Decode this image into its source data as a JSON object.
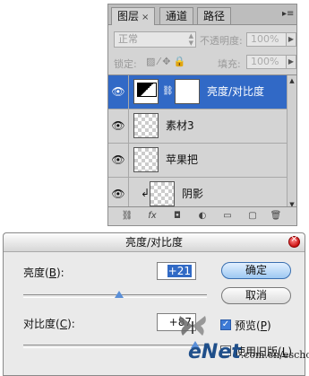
{
  "layers_panel": {
    "tabs": [
      {
        "label": "图层",
        "close": "×"
      },
      {
        "label": "通道"
      },
      {
        "label": "路径"
      }
    ],
    "blend_mode": "正常",
    "opacity_label": "不透明度:",
    "opacity_value": "100%",
    "lock_label": "锁定:",
    "fill_label": "填充:",
    "fill_value": "100%",
    "layers": [
      {
        "name": "亮度/对比度",
        "selected": true
      },
      {
        "name": "素材3",
        "selected": false
      },
      {
        "name": "苹果把",
        "selected": false
      },
      {
        "name": "阴影",
        "selected": false
      }
    ]
  },
  "dialog": {
    "title": "亮度/对比度",
    "brightness_label": "亮度",
    "brightness_key": "B",
    "brightness_value": "+21",
    "contrast_label": "对比度",
    "contrast_key": "C",
    "contrast_value": "+87",
    "ok_label": "确定",
    "cancel_label": "取消",
    "preview_label": "预览",
    "preview_key": "P",
    "preview_checked": true,
    "legacy_label": "使用旧版",
    "legacy_key": "L",
    "legacy_checked": false,
    "brightness_level": 0.521,
    "contrast_level": 0.935
  },
  "watermark": {
    "brand": "eNet",
    "url": ".com.cn/eschool"
  },
  "colors": {
    "selection": "#3169c6",
    "panel_bg": "#d4d4d4",
    "dialog_bg": "#eaeaea",
    "close_red": "#cc1111"
  }
}
